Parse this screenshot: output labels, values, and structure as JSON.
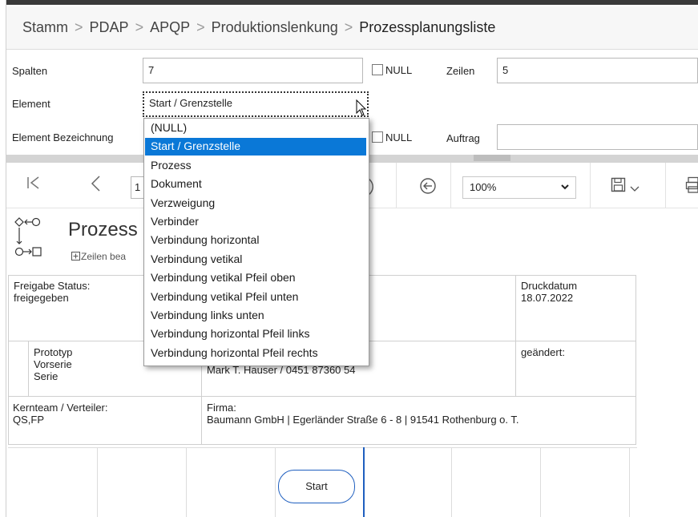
{
  "breadcrumb": {
    "items": [
      "Stamm",
      "PDAP",
      "APQP",
      "Produktionslenkung"
    ],
    "current": "Prozessplanungsliste",
    "separator": ">"
  },
  "form": {
    "spalten_label": "Spalten",
    "spalten_value": "7",
    "null_label": "NULL",
    "zeilen_label": "Zeilen",
    "zeilen_value": "5",
    "element_label": "Element",
    "element_value": "Start / Grenzstelle",
    "element_bez_label": "Element Bezeichnung",
    "auftrag_label": "Auftrag",
    "auftrag_value": ""
  },
  "dropdown": {
    "options": [
      "(NULL)",
      "Start / Grenzstelle",
      "Prozess",
      "Dokument",
      "Verzweigung",
      "Verbinder",
      "Verbindung horizontal",
      "Verbindung vetikal",
      "Verbindung vetikal Pfeil oben",
      "Verbindung vetikal Pfeil unten",
      "Verbindung links unten",
      "Verbindung horizontal Pfeil links",
      "Verbindung horizontal Pfeil rechts"
    ],
    "selected_index": 1
  },
  "toolbar": {
    "page_value": "1",
    "zoom_value": "100%"
  },
  "report": {
    "title": "Prozess",
    "expand_label": "Zeilen bea",
    "freigabe_label": "Freigabe Status:",
    "freigabe_value": "freigegeben",
    "druckdatum_label": "Druckdatum",
    "druckdatum_value": "18.07.2022",
    "phase_items": [
      "Prototyp",
      "Vorserie",
      "Serie"
    ],
    "contact_value": "Mark T. Hauser / 0451 87360 54",
    "geaendert_label": "geändert:",
    "kernteam_label": "Kernteam / Verteiler:",
    "kernteam_value": "QS,FP",
    "firma_label": "Firma:",
    "firma_value": "Baumann GmbH | Egerländer Straße 6 - 8 | 91541 Rothenburg o. T.",
    "start_label": "Start"
  },
  "colors": {
    "selection": "#0a78d7",
    "accent_line": "#1f5fbf"
  }
}
